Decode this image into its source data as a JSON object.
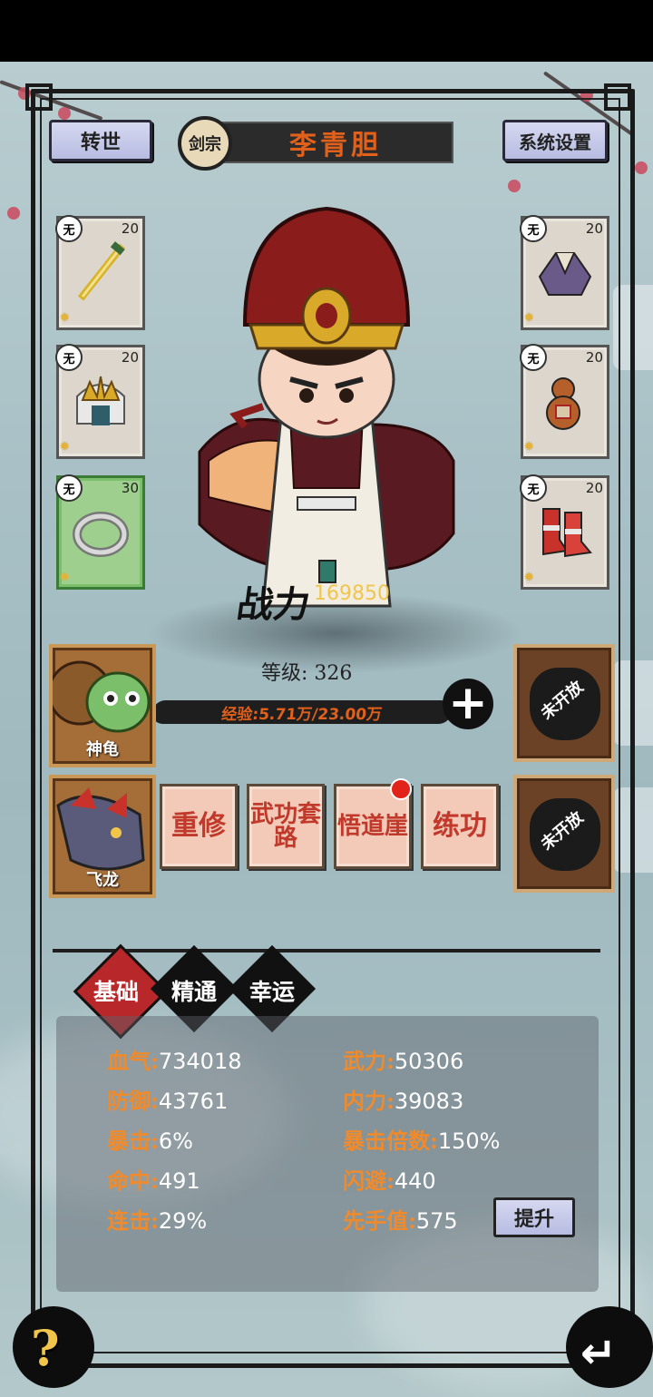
{
  "header": {
    "rebirth_label": "转世",
    "sect_label": "剑宗",
    "character_name": "李青胆",
    "settings_label": "系统设置"
  },
  "equipment": {
    "left": [
      {
        "element": "无",
        "level": "20",
        "item": "sword-icon"
      },
      {
        "element": "无",
        "level": "20",
        "item": "crown-icon"
      },
      {
        "element": "无",
        "level": "30",
        "item": "ring-icon"
      }
    ],
    "right": [
      {
        "element": "无",
        "level": "20",
        "item": "robe-icon"
      },
      {
        "element": "无",
        "level": "20",
        "item": "gourd-icon"
      },
      {
        "element": "无",
        "level": "20",
        "item": "boots-icon"
      }
    ]
  },
  "power": {
    "label": "战力",
    "value": "169850"
  },
  "level": {
    "text": "等级: 326"
  },
  "exp": {
    "text": "经验:5.71万/23.00万"
  },
  "pets": [
    {
      "name": "神龟"
    },
    {
      "name": "飞龙"
    }
  ],
  "locked_slots": [
    {
      "label": "未开放"
    },
    {
      "label": "未开放"
    }
  ],
  "actions": [
    {
      "label": "重修"
    },
    {
      "label": "武功套路"
    },
    {
      "label": "悟道崖"
    },
    {
      "label": "练功"
    }
  ],
  "tabs": [
    {
      "label": "基础",
      "active": true
    },
    {
      "label": "精通",
      "active": false
    },
    {
      "label": "幸运",
      "active": false
    }
  ],
  "stats": {
    "left": [
      {
        "key": "血气:",
        "value": "734018"
      },
      {
        "key": "防御:",
        "value": "43761"
      },
      {
        "key": "暴击:",
        "value": "6%"
      },
      {
        "key": "命中:",
        "value": "491"
      },
      {
        "key": "连击:",
        "value": "29%"
      }
    ],
    "right": [
      {
        "key": "武力:",
        "value": "50306"
      },
      {
        "key": "内力:",
        "value": "39083"
      },
      {
        "key": "暴击倍数:",
        "value": "150%"
      },
      {
        "key": "闪避:",
        "value": "440"
      },
      {
        "key": "先手值:",
        "value": "575"
      }
    ],
    "upgrade_label": "提升"
  },
  "footer": {
    "help_label": "?"
  }
}
